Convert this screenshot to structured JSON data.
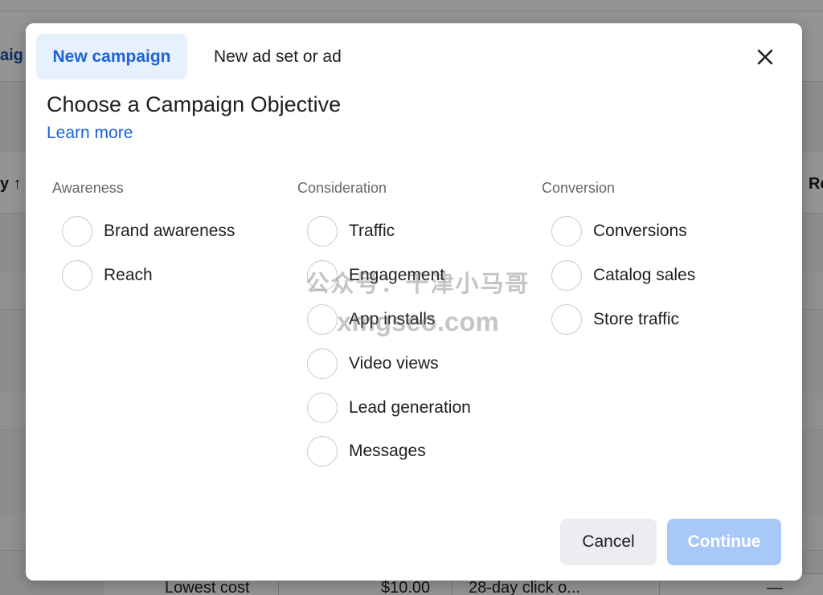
{
  "background": {
    "left_fragments": [
      "aig",
      "y ↑"
    ],
    "right_fragment": "Re",
    "table_row": {
      "bid_strategy": "Lowest cost",
      "budget": "$10.00",
      "attribution": "28-day click o...",
      "dash": "—"
    }
  },
  "modal": {
    "tabs": [
      {
        "label": "New campaign",
        "active": true
      },
      {
        "label": "New ad set or ad",
        "active": false
      }
    ],
    "close_icon": "close-icon",
    "title": "Choose a Campaign Objective",
    "learn_more": "Learn more",
    "groups": [
      {
        "label": "Awareness",
        "options": [
          "Brand awareness",
          "Reach"
        ]
      },
      {
        "label": "Consideration",
        "options": [
          "Traffic",
          "Engagement",
          "App installs",
          "Video views",
          "Lead generation",
          "Messages"
        ]
      },
      {
        "label": "Conversion",
        "options": [
          "Conversions",
          "Catalog sales",
          "Store traffic"
        ]
      }
    ],
    "buttons": {
      "cancel": "Cancel",
      "continue": "Continue"
    }
  },
  "watermark": {
    "line1": "公众号：千津小马哥",
    "line2": "xmgseo.com"
  },
  "colors": {
    "accent": "#1b63d6",
    "tab_active_bg": "#e7f0fd",
    "continue_disabled": "#a8c8f8",
    "overlay": "rgba(0,0,0,0.42)"
  }
}
